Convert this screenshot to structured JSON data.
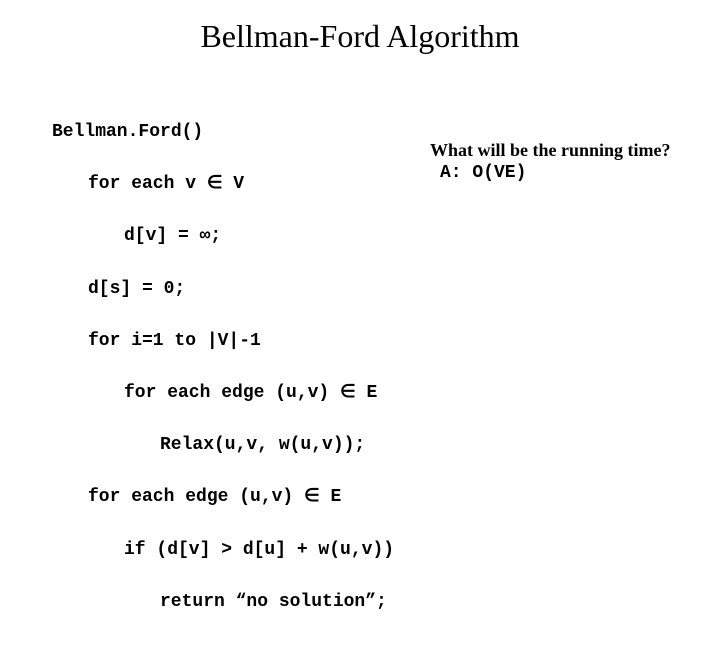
{
  "title": "Bellman-Ford Algorithm",
  "code": {
    "l1": "Bellman.Ford()",
    "l2": "for each v ∈ V",
    "l3": "d[v] = ∞;",
    "l4": "d[s] = 0;",
    "l5": "for i=1 to |V|-1",
    "l6": "for each edge (u,v) ∈ E",
    "l7": "Relax(u,v, w(u,v));",
    "l8": "for each edge (u,v) ∈ E",
    "l9": "if (d[v] > d[u] + w(u,v))",
    "l10": "return “no solution”;"
  },
  "question": "What will be the running time?",
  "answer": "A: O(VE)"
}
